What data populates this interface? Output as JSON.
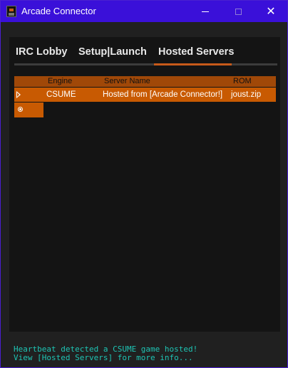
{
  "window": {
    "title": "Arcade Connector",
    "controls": {
      "minimize": "minimize",
      "maximize": "maximize",
      "close": "✕"
    }
  },
  "tabs": [
    {
      "label": "IRC Lobby",
      "active": false
    },
    {
      "label": "Setup|Launch",
      "active": false
    },
    {
      "label": "Hosted Servers",
      "active": true
    }
  ],
  "grid": {
    "columns": [
      "Engine",
      "Server Name",
      "ROM"
    ],
    "rows": [
      {
        "engine": "CSUME",
        "server_name": "Hosted from [Arcade Connector!]",
        "rom": "joust.zip"
      }
    ]
  },
  "status": {
    "line1": "Heartbeat detected a CSUME game hosted!",
    "line2": "View [Hosted Servers] for more info..."
  },
  "colors": {
    "titlebar": "#3a10d9",
    "accent": "#c85a02",
    "status_text": "#1ec4b4",
    "background": "#202020"
  }
}
